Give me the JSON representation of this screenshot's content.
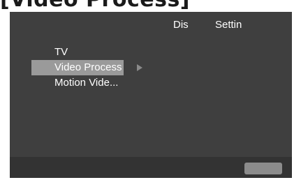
{
  "heading": "[Video Process]",
  "tabs": [
    {
      "label": "Dis"
    },
    {
      "label": "Settin"
    }
  ],
  "menu": {
    "items": [
      {
        "label": "TV"
      },
      {
        "label": "Video Process"
      },
      {
        "label": "Motion Vide..."
      }
    ],
    "selected_index": 1
  },
  "colors": {
    "screen_background": "#3f3f3f",
    "bottom_bar": "#333333",
    "selection_highlight": "#9a9a9a",
    "text": "#ffffff"
  },
  "icons": {
    "submenu_arrow": "triangle-right-icon"
  }
}
